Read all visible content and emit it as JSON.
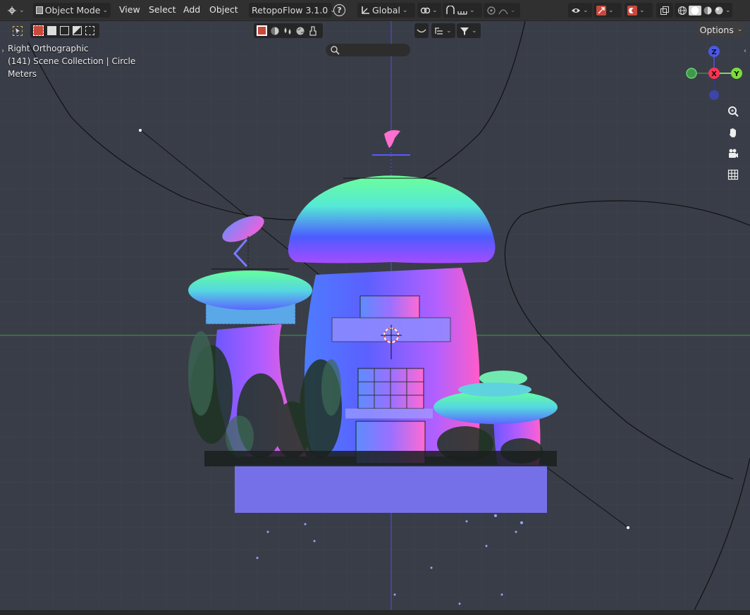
{
  "header": {
    "mode": "Object Mode",
    "menus": {
      "view": "View",
      "select": "Select",
      "add": "Add",
      "object": "Object"
    },
    "addon": "RetopoFlow 3.1.0",
    "help_icon": "?",
    "transform_orientation": "Global"
  },
  "tool_header": {
    "options_label": "Options"
  },
  "viewport_info": {
    "view_name": "Right Orthographic",
    "collection": "(141) Scene Collection | Circle",
    "units": "Meters"
  },
  "gizmo": {
    "z_label": "Z",
    "x_label": "X",
    "y_label": "Y"
  },
  "colors": {
    "viewport_bg": "#393d47",
    "header_bg": "#303030",
    "axis_x": "#ff3352",
    "axis_y": "#8bdc00",
    "axis_z": "#2890ff",
    "base_platform": "#7670e8"
  },
  "icons": {
    "editor_type": "editor-type-icon",
    "mode": "object-mode-icon",
    "orientation": "transform-orientation-icon",
    "snap": "snap-icon",
    "proportional": "proportional-editing-icon",
    "visibility": "visibility-icon",
    "gizmo": "gizmo-icon",
    "overlay": "overlay-icon",
    "xray": "xray-icon",
    "shading": [
      "wireframe-shading-icon",
      "solid-shading-icon",
      "material-shading-icon",
      "rendered-shading-icon"
    ],
    "navigation": [
      "zoom-icon",
      "pan-hand-icon",
      "camera-icon",
      "grid-icon"
    ]
  }
}
